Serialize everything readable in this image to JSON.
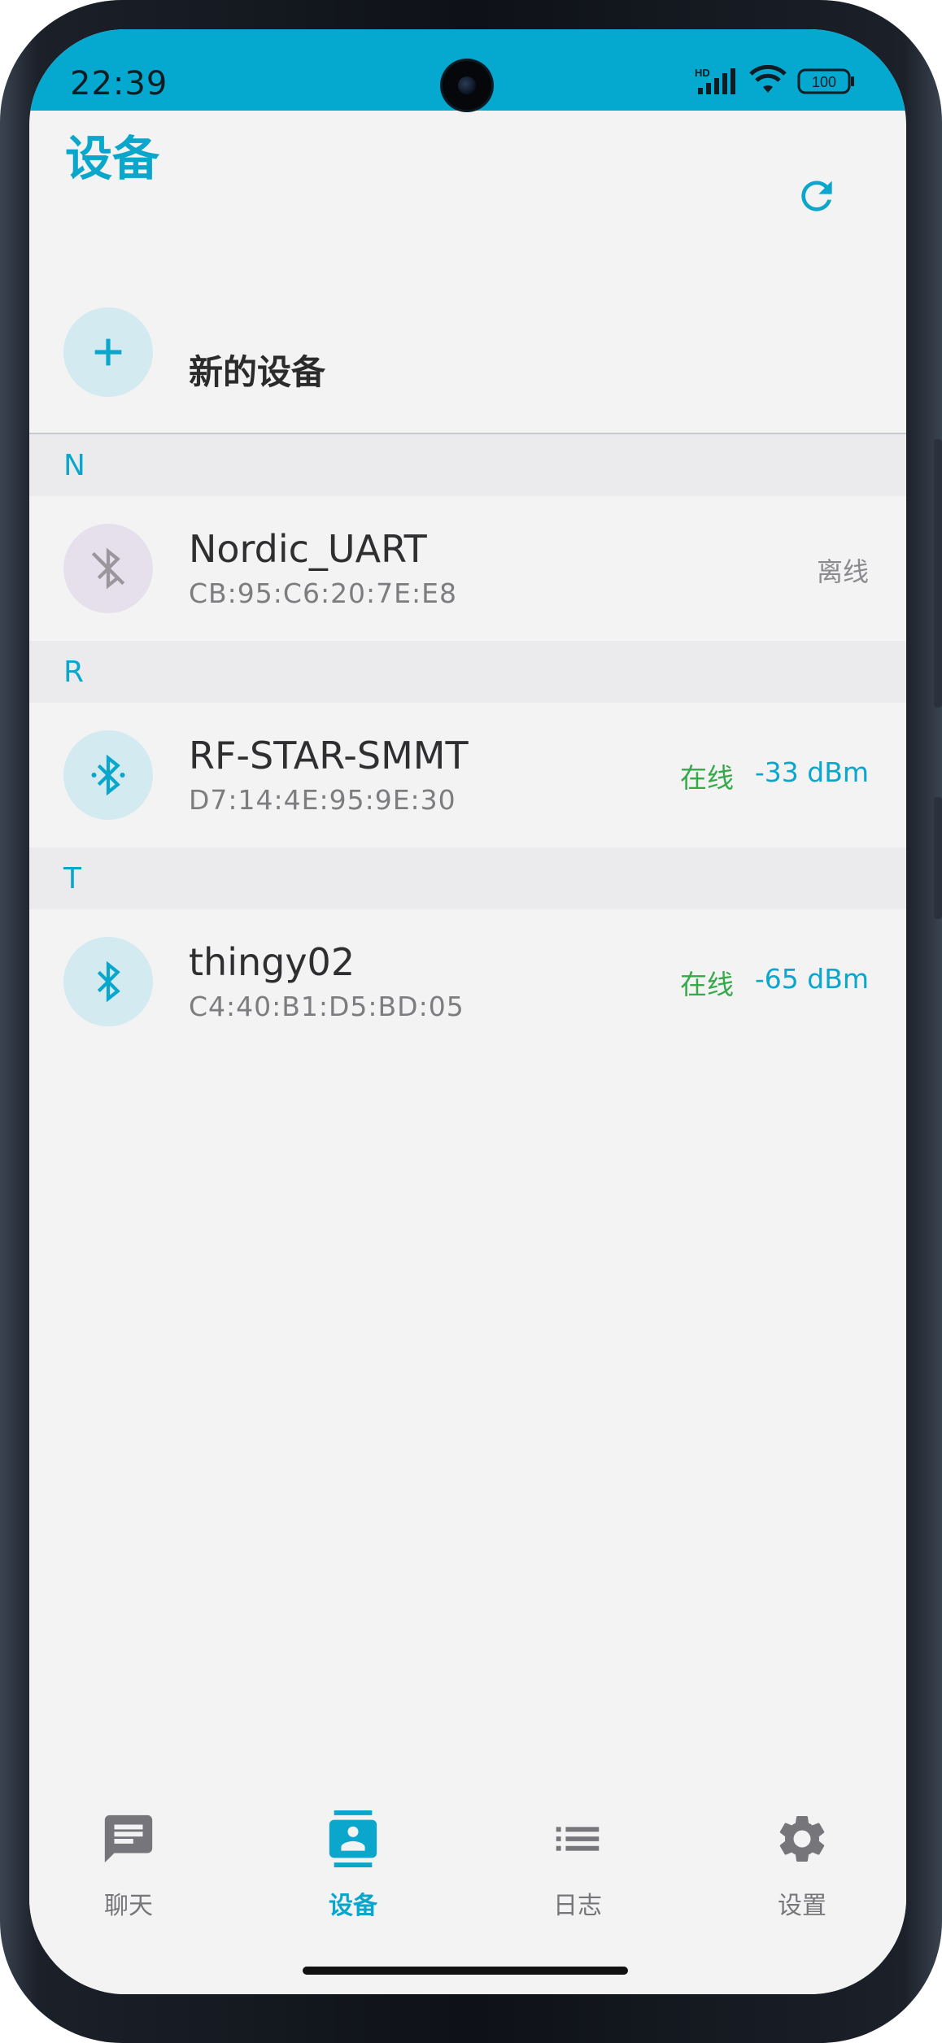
{
  "status_bar": {
    "time": "22:39",
    "network_label": "HD",
    "battery": "100"
  },
  "header": {
    "title": "设备"
  },
  "new_device": {
    "label": "新的设备"
  },
  "sections": [
    {
      "letter": "N",
      "device": {
        "name": "Nordic_UART",
        "mac": "CB:95:C6:20:7E:E8",
        "status": "离线",
        "rssi": ""
      }
    },
    {
      "letter": "R",
      "device": {
        "name": "RF-STAR-SMMT",
        "mac": "D7:14:4E:95:9E:30",
        "status": "在线",
        "rssi": "-33 dBm"
      }
    },
    {
      "letter": "T",
      "device": {
        "name": "thingy02",
        "mac": "C4:40:B1:D5:BD:05",
        "status": "在线",
        "rssi": "-65 dBm"
      }
    }
  ],
  "nav": {
    "items": [
      {
        "label": "聊天",
        "icon": "chat-icon",
        "active": false
      },
      {
        "label": "设备",
        "icon": "contacts-icon",
        "active": true
      },
      {
        "label": "日志",
        "icon": "list-icon",
        "active": false
      },
      {
        "label": "设置",
        "icon": "gear-icon",
        "active": false
      }
    ]
  },
  "colors": {
    "accent": "#0aa6cb",
    "status_bar": "#05a9d0",
    "online": "#36a94a",
    "offline": "#8b8b8f",
    "background": "#f3f3f4"
  }
}
